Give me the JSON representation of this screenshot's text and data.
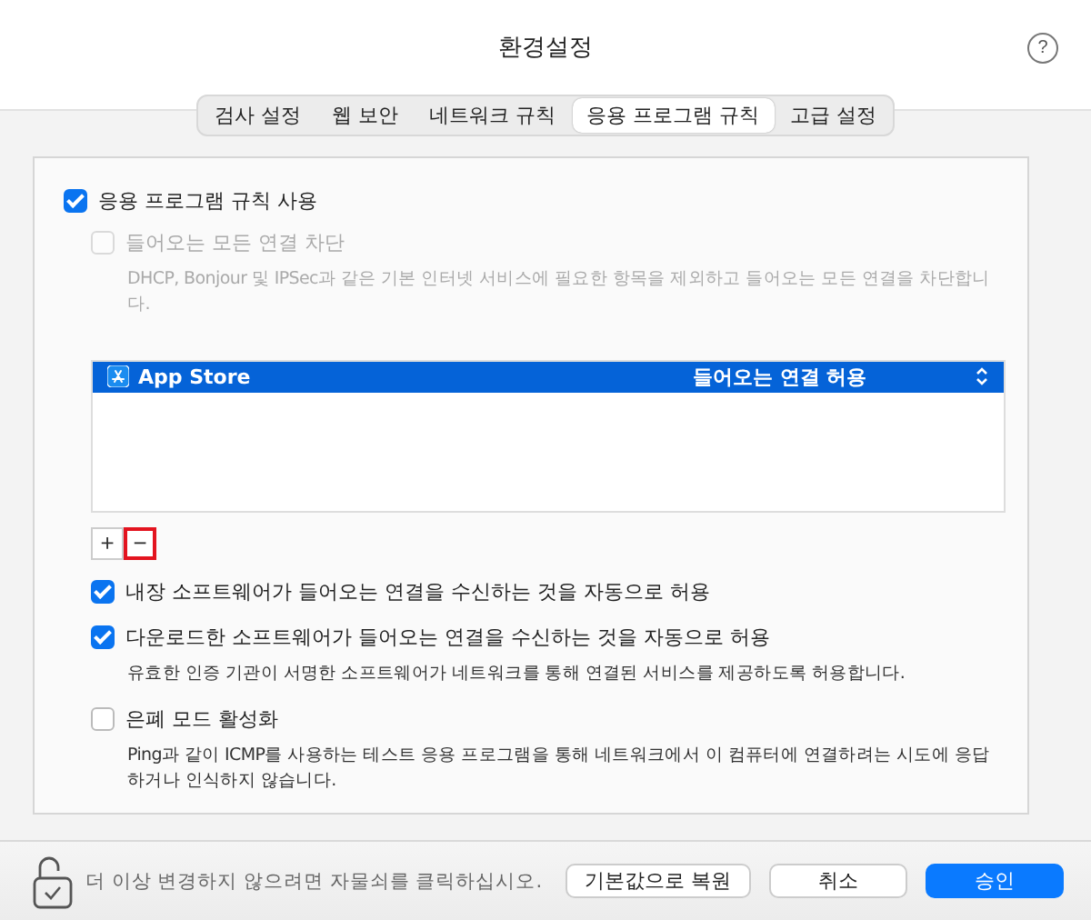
{
  "window": {
    "title": "환경설정",
    "help": "?"
  },
  "tabs": [
    {
      "label": "검사 설정",
      "selected": false
    },
    {
      "label": "웹 보안",
      "selected": false
    },
    {
      "label": "네트워크 규칙",
      "selected": false
    },
    {
      "label": "응용 프로그램 규칙",
      "selected": true
    },
    {
      "label": "고급 설정",
      "selected": false
    }
  ],
  "app_rules": {
    "enabled": {
      "label": "응용 프로그램 규칙 사용",
      "checked": true,
      "disabled": false
    },
    "block_all": {
      "label": "들어오는 모든 연결 차단",
      "checked": false,
      "disabled": true,
      "description": "DHCP, Bonjour 및 IPSec과 같은 기본 인터넷 서비스에 필요한 항목을 제외하고 들어오는 모든 연결을 차단합니다."
    },
    "apps": [
      {
        "name": "App Store",
        "rule": "들어오는 연결 허용",
        "selected": true
      }
    ],
    "add_button": {
      "label": "+",
      "highlighted": false
    },
    "remove_button": {
      "label": "−",
      "highlighted": true
    },
    "options": [
      {
        "label": "내장 소프트웨어가 들어오는 연결을 수신하는 것을 자동으로 허용",
        "checked": true,
        "disabled": false
      },
      {
        "label": "다운로드한 소프트웨어가 들어오는 연결을 수신하는 것을 자동으로 허용",
        "checked": true,
        "disabled": false,
        "description": "유효한 인증 기관이 서명한 소프트웨어가 네트워크를 통해 연결된 서비스를 제공하도록 허용합니다."
      },
      {
        "label": "은폐 모드 활성화",
        "checked": false,
        "disabled": false,
        "description": "Ping과 같이 ICMP를 사용하는 테스트 응용 프로그램을 통해 네트워크에서 이 컴퓨터에 연결하려는 시도에 응답하거나 인식하지 않습니다."
      }
    ]
  },
  "footer": {
    "lock_text": "더 이상 변경하지 않으려면 자물쇠를 클릭하십시오.",
    "buttons": [
      {
        "label": "기본값으로 복원",
        "kind": "default"
      },
      {
        "label": "취소",
        "kind": "default"
      },
      {
        "label": "승인",
        "kind": "primary"
      }
    ]
  }
}
